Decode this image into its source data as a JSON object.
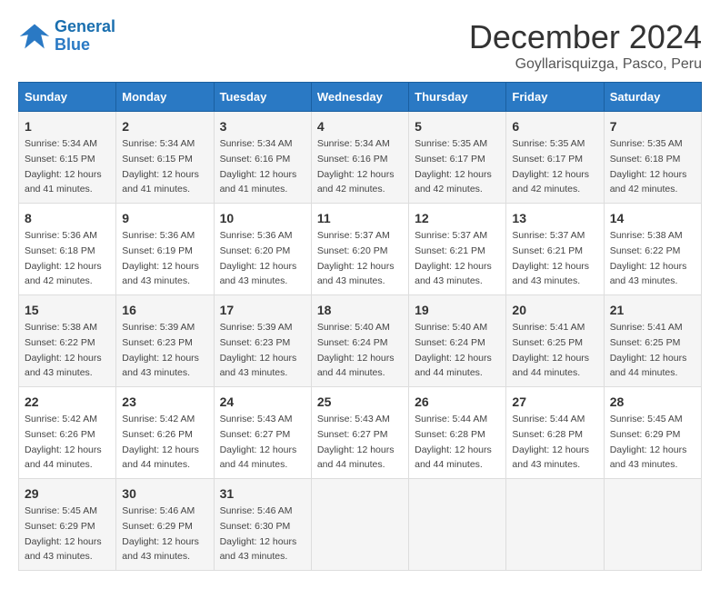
{
  "header": {
    "logo_line1": "General",
    "logo_line2": "Blue",
    "month_title": "December 2024",
    "location": "Goyllarisquizga, Pasco, Peru"
  },
  "days_of_week": [
    "Sunday",
    "Monday",
    "Tuesday",
    "Wednesday",
    "Thursday",
    "Friday",
    "Saturday"
  ],
  "weeks": [
    [
      {
        "day": 1,
        "sunrise": "5:34 AM",
        "sunset": "6:15 PM",
        "daylight": "12 hours and 41 minutes."
      },
      {
        "day": 2,
        "sunrise": "5:34 AM",
        "sunset": "6:15 PM",
        "daylight": "12 hours and 41 minutes."
      },
      {
        "day": 3,
        "sunrise": "5:34 AM",
        "sunset": "6:16 PM",
        "daylight": "12 hours and 41 minutes."
      },
      {
        "day": 4,
        "sunrise": "5:34 AM",
        "sunset": "6:16 PM",
        "daylight": "12 hours and 42 minutes."
      },
      {
        "day": 5,
        "sunrise": "5:35 AM",
        "sunset": "6:17 PM",
        "daylight": "12 hours and 42 minutes."
      },
      {
        "day": 6,
        "sunrise": "5:35 AM",
        "sunset": "6:17 PM",
        "daylight": "12 hours and 42 minutes."
      },
      {
        "day": 7,
        "sunrise": "5:35 AM",
        "sunset": "6:18 PM",
        "daylight": "12 hours and 42 minutes."
      }
    ],
    [
      {
        "day": 8,
        "sunrise": "5:36 AM",
        "sunset": "6:18 PM",
        "daylight": "12 hours and 42 minutes."
      },
      {
        "day": 9,
        "sunrise": "5:36 AM",
        "sunset": "6:19 PM",
        "daylight": "12 hours and 43 minutes."
      },
      {
        "day": 10,
        "sunrise": "5:36 AM",
        "sunset": "6:20 PM",
        "daylight": "12 hours and 43 minutes."
      },
      {
        "day": 11,
        "sunrise": "5:37 AM",
        "sunset": "6:20 PM",
        "daylight": "12 hours and 43 minutes."
      },
      {
        "day": 12,
        "sunrise": "5:37 AM",
        "sunset": "6:21 PM",
        "daylight": "12 hours and 43 minutes."
      },
      {
        "day": 13,
        "sunrise": "5:37 AM",
        "sunset": "6:21 PM",
        "daylight": "12 hours and 43 minutes."
      },
      {
        "day": 14,
        "sunrise": "5:38 AM",
        "sunset": "6:22 PM",
        "daylight": "12 hours and 43 minutes."
      }
    ],
    [
      {
        "day": 15,
        "sunrise": "5:38 AM",
        "sunset": "6:22 PM",
        "daylight": "12 hours and 43 minutes."
      },
      {
        "day": 16,
        "sunrise": "5:39 AM",
        "sunset": "6:23 PM",
        "daylight": "12 hours and 43 minutes."
      },
      {
        "day": 17,
        "sunrise": "5:39 AM",
        "sunset": "6:23 PM",
        "daylight": "12 hours and 43 minutes."
      },
      {
        "day": 18,
        "sunrise": "5:40 AM",
        "sunset": "6:24 PM",
        "daylight": "12 hours and 44 minutes."
      },
      {
        "day": 19,
        "sunrise": "5:40 AM",
        "sunset": "6:24 PM",
        "daylight": "12 hours and 44 minutes."
      },
      {
        "day": 20,
        "sunrise": "5:41 AM",
        "sunset": "6:25 PM",
        "daylight": "12 hours and 44 minutes."
      },
      {
        "day": 21,
        "sunrise": "5:41 AM",
        "sunset": "6:25 PM",
        "daylight": "12 hours and 44 minutes."
      }
    ],
    [
      {
        "day": 22,
        "sunrise": "5:42 AM",
        "sunset": "6:26 PM",
        "daylight": "12 hours and 44 minutes."
      },
      {
        "day": 23,
        "sunrise": "5:42 AM",
        "sunset": "6:26 PM",
        "daylight": "12 hours and 44 minutes."
      },
      {
        "day": 24,
        "sunrise": "5:43 AM",
        "sunset": "6:27 PM",
        "daylight": "12 hours and 44 minutes."
      },
      {
        "day": 25,
        "sunrise": "5:43 AM",
        "sunset": "6:27 PM",
        "daylight": "12 hours and 44 minutes."
      },
      {
        "day": 26,
        "sunrise": "5:44 AM",
        "sunset": "6:28 PM",
        "daylight": "12 hours and 44 minutes."
      },
      {
        "day": 27,
        "sunrise": "5:44 AM",
        "sunset": "6:28 PM",
        "daylight": "12 hours and 43 minutes."
      },
      {
        "day": 28,
        "sunrise": "5:45 AM",
        "sunset": "6:29 PM",
        "daylight": "12 hours and 43 minutes."
      }
    ],
    [
      {
        "day": 29,
        "sunrise": "5:45 AM",
        "sunset": "6:29 PM",
        "daylight": "12 hours and 43 minutes."
      },
      {
        "day": 30,
        "sunrise": "5:46 AM",
        "sunset": "6:29 PM",
        "daylight": "12 hours and 43 minutes."
      },
      {
        "day": 31,
        "sunrise": "5:46 AM",
        "sunset": "6:30 PM",
        "daylight": "12 hours and 43 minutes."
      },
      null,
      null,
      null,
      null
    ]
  ],
  "labels": {
    "sunrise": "Sunrise:",
    "sunset": "Sunset:",
    "daylight": "Daylight:"
  }
}
